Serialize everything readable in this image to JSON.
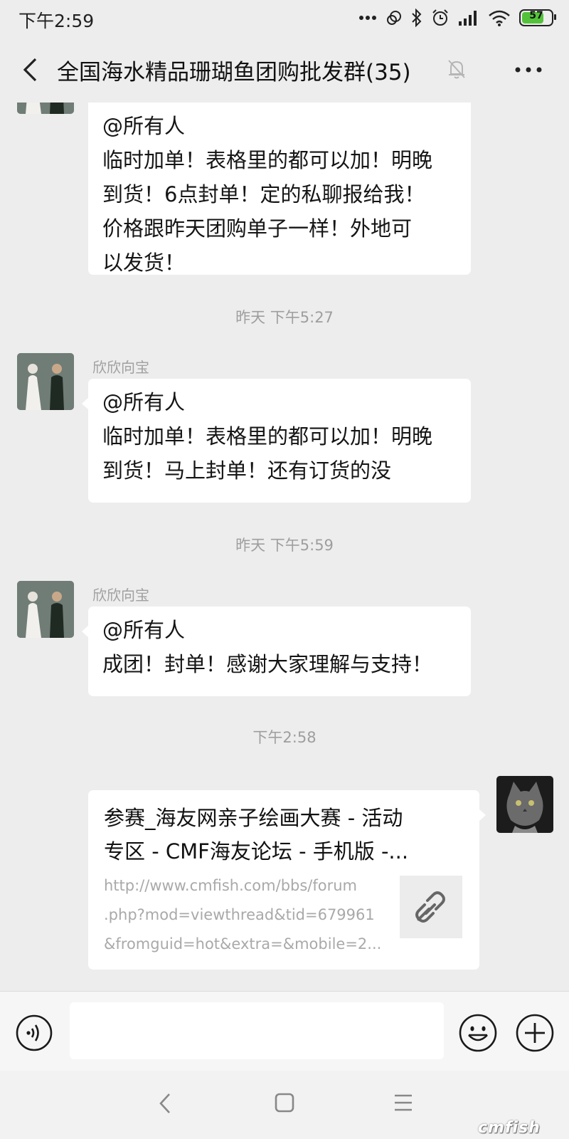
{
  "status_bar": {
    "time": "下午2:59",
    "battery": "57"
  },
  "header": {
    "title": "全国海水精品珊瑚鱼团购批发群(35)"
  },
  "messages": {
    "m0": {
      "lines": [
        "@所有人",
        "临时加单！表格里的都可以加！明晚",
        "到货！6点封单！定的私聊报给我！",
        "价格跟昨天团购单子一样！外地可",
        "以发货！"
      ]
    },
    "ts1": "昨天 下午5:27",
    "m1": {
      "sender": "欣欣向宝",
      "lines": [
        "@所有人",
        "临时加单！表格里的都可以加！明晚",
        "到货！马上封单！还有订货的没"
      ]
    },
    "ts2": "昨天 下午5:59",
    "m2": {
      "sender": "欣欣向宝",
      "lines": [
        "@所有人",
        "成团！封单！感谢大家理解与支持！"
      ]
    },
    "ts3": "下午2:58",
    "link": {
      "title_lines": [
        "参赛_海友网亲子绘画大赛 - 活动",
        "专区 - CMF海友论坛 - 手机版 -..."
      ],
      "url_lines": [
        "http://www.cmfish.com/bbs/forum",
        ".php?mod=viewthread&tid=679961",
        "&fromguid=hot&extra=&mobile=2..."
      ]
    }
  },
  "input": {
    "placeholder": ""
  },
  "watermark": "cmfish"
}
